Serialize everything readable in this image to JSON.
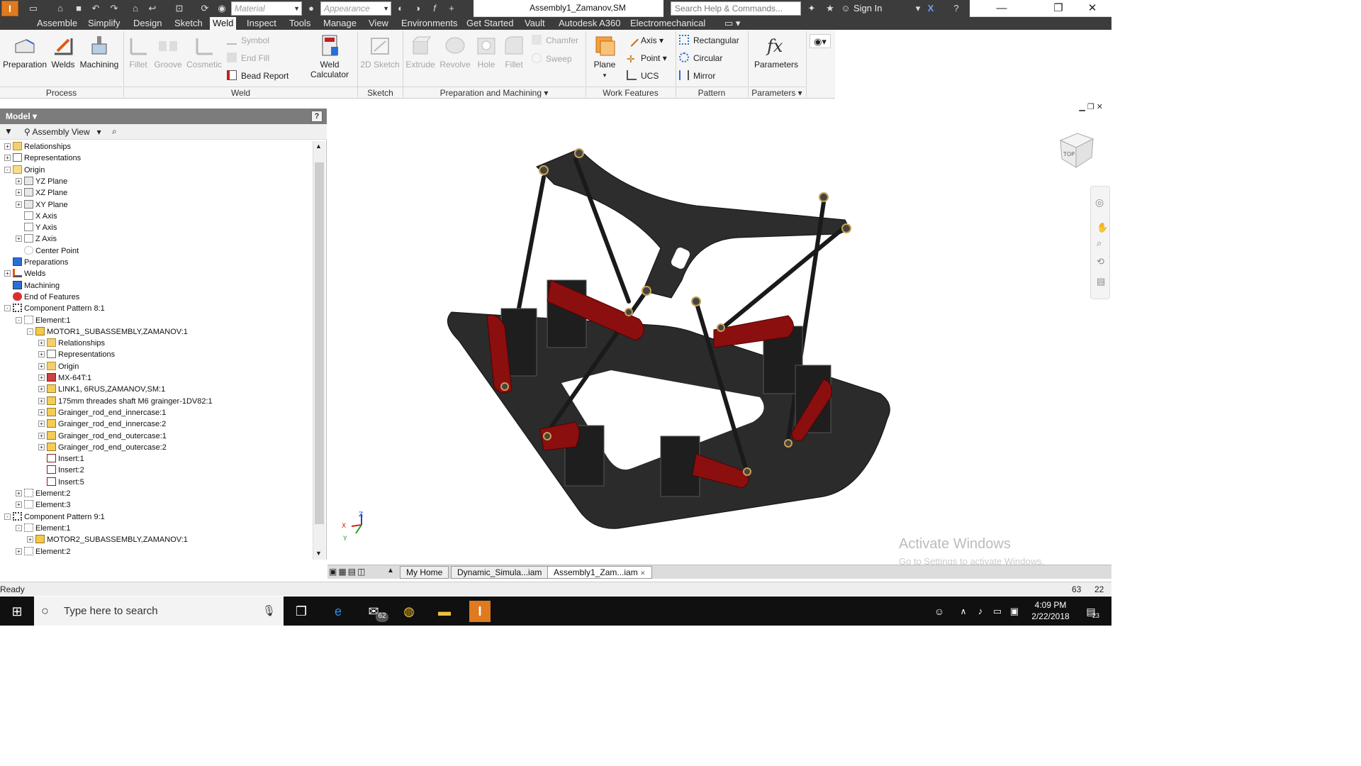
{
  "titlebar": {
    "material_placeholder": "Material",
    "appearance_placeholder": "Appearance",
    "document_title": "Assembly1_Zamanov,SM",
    "search_placeholder": "Search Help & Commands...",
    "sign_in": "Sign In"
  },
  "tabs": [
    "Assemble",
    "Simplify",
    "Design",
    "Sketch",
    "Weld",
    "Inspect",
    "Tools",
    "Manage",
    "View",
    "Environments",
    "Get Started",
    "Vault",
    "Autodesk A360",
    "Electromechanical"
  ],
  "active_tab": "Weld",
  "ribbon": {
    "process": {
      "label": "Process",
      "preparation": "Preparation",
      "welds": "Welds",
      "machining": "Machining"
    },
    "weld": {
      "label": "Weld",
      "fillet": "Fillet",
      "groove": "Groove",
      "cosmetic": "Cosmetic",
      "symbol": "Symbol",
      "end_fill": "End Fill",
      "bead_report": "Bead Report",
      "weld_calculator_1": "Weld",
      "weld_calculator_2": "Calculator"
    },
    "sketch": {
      "label": "Sketch",
      "sketch2d": "2D Sketch"
    },
    "prep_machining": {
      "label": "Preparation and Machining",
      "extrude": "Extrude",
      "revolve": "Revolve",
      "hole": "Hole",
      "fillet": "Fillet",
      "chamfer": "Chamfer",
      "sweep": "Sweep"
    },
    "work_features": {
      "label": "Work Features",
      "plane": "Plane",
      "axis": "Axis",
      "point": "Point",
      "ucs": "UCS"
    },
    "pattern": {
      "label": "Pattern",
      "rectangular": "Rectangular",
      "circular": "Circular",
      "mirror": "Mirror"
    },
    "parameters": {
      "label": "Parameters",
      "parameters": "Parameters"
    }
  },
  "browser": {
    "title": "Model",
    "view": "Assembly View",
    "tree": [
      {
        "label": "Relationships",
        "level": 0,
        "expand": "+",
        "icon": "folder"
      },
      {
        "label": "Representations",
        "level": 0,
        "expand": "+",
        "icon": "rep"
      },
      {
        "label": "Origin",
        "level": 0,
        "expand": "-",
        "icon": "folder-open"
      },
      {
        "label": "YZ Plane",
        "level": 1,
        "expand": "+",
        "icon": "plane"
      },
      {
        "label": "XZ Plane",
        "level": 1,
        "expand": "+",
        "icon": "plane"
      },
      {
        "label": "XY Plane",
        "level": 1,
        "expand": "+",
        "icon": "plane"
      },
      {
        "label": "X Axis",
        "level": 1,
        "expand": "",
        "icon": "axis"
      },
      {
        "label": "Y Axis",
        "level": 1,
        "expand": "",
        "icon": "axis"
      },
      {
        "label": "Z Axis",
        "level": 1,
        "expand": "+",
        "icon": "axis"
      },
      {
        "label": "Center Point",
        "level": 1,
        "expand": "",
        "icon": "point"
      },
      {
        "label": "Preparations",
        "level": 0,
        "expand": "",
        "icon": "prep"
      },
      {
        "label": "Welds",
        "level": 0,
        "expand": "+",
        "icon": "weld"
      },
      {
        "label": "Machining",
        "level": 0,
        "expand": "",
        "icon": "machining"
      },
      {
        "label": "End of Features",
        "level": 0,
        "expand": "",
        "icon": "eof"
      },
      {
        "label": "Component Pattern 8:1",
        "level": 0,
        "expand": "-",
        "icon": "pattern"
      },
      {
        "label": "Element:1",
        "level": 1,
        "expand": "-",
        "icon": "element"
      },
      {
        "label": "MOTOR1_SUBASSEMBLY,ZAMANOV:1",
        "level": 2,
        "expand": "-",
        "icon": "assembly"
      },
      {
        "label": "Relationships",
        "level": 3,
        "expand": "+",
        "icon": "folder"
      },
      {
        "label": "Representations",
        "level": 3,
        "expand": "+",
        "icon": "rep"
      },
      {
        "label": "Origin",
        "level": 3,
        "expand": "+",
        "icon": "folder"
      },
      {
        "label": "MX-64T:1",
        "level": 3,
        "expand": "+",
        "icon": "part-red"
      },
      {
        "label": "LINK1, 6RUS,ZAMANOV,SM:1",
        "level": 3,
        "expand": "+",
        "icon": "part"
      },
      {
        "label": "175mm threades shaft M6 grainger-1DV82:1",
        "level": 3,
        "expand": "+",
        "icon": "part"
      },
      {
        "label": "Grainger_rod_end_innercase:1",
        "level": 3,
        "expand": "+",
        "icon": "part"
      },
      {
        "label": "Grainger_rod_end_innercase:2",
        "level": 3,
        "expand": "+",
        "icon": "part"
      },
      {
        "label": "Grainger_rod_end_outercase:1",
        "level": 3,
        "expand": "+",
        "icon": "part"
      },
      {
        "label": "Grainger_rod_end_outercase:2",
        "level": 3,
        "expand": "+",
        "icon": "part"
      },
      {
        "label": "Insert:1",
        "level": 3,
        "expand": "",
        "icon": "insert"
      },
      {
        "label": "Insert:2",
        "level": 3,
        "expand": "",
        "icon": "insert"
      },
      {
        "label": "Insert:5",
        "level": 3,
        "expand": "",
        "icon": "insert"
      },
      {
        "label": "Element:2",
        "level": 1,
        "expand": "+",
        "icon": "element"
      },
      {
        "label": "Element:3",
        "level": 1,
        "expand": "+",
        "icon": "element"
      },
      {
        "label": "Component Pattern 9:1",
        "level": 0,
        "expand": "-",
        "icon": "pattern"
      },
      {
        "label": "Element:1",
        "level": 1,
        "expand": "-",
        "icon": "element"
      },
      {
        "label": "MOTOR2_SUBASSEMBLY,ZAMANOV:1",
        "level": 2,
        "expand": "+",
        "icon": "assembly"
      },
      {
        "label": "Element:2",
        "level": 1,
        "expand": "+",
        "icon": "element"
      }
    ]
  },
  "viewcube_label": "TOP",
  "watermark": {
    "line1": "Activate Windows",
    "line2": "Go to Settings to activate Windows."
  },
  "doc_tabs": [
    "My Home",
    "Dynamic_Simula...iam",
    "Assembly1_Zam...iam"
  ],
  "status": {
    "text": "Ready",
    "num1": "63",
    "num2": "22"
  },
  "taskbar": {
    "search_placeholder": "Type here to search",
    "mail_badge": "62",
    "time": "4:09 PM",
    "date": "2/22/2018",
    "notif_badge": "23"
  },
  "colors": {
    "chrome_dark": "#3c3c3c",
    "ribbon_bg": "#f5f5f5",
    "part_red": "#8b0f0f",
    "part_black": "#222222"
  }
}
